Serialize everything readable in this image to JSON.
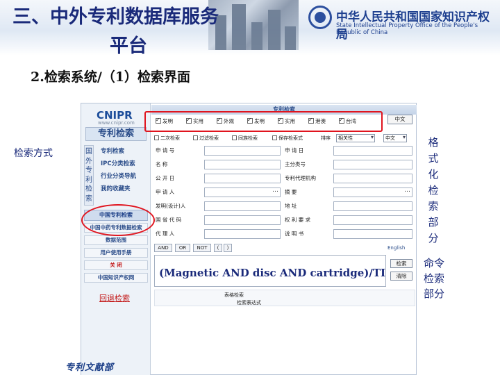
{
  "slide": {
    "title": "三、中外专利数据库服务平台",
    "title_line1": "三、中外专利数据库服务",
    "title_line2": "平台",
    "section": "2.检索系统/（1）检索界面",
    "logo_cn": "中华人民共和国国家知识产权局",
    "logo_en": "State Intellectual Property Office of the People's Republic of China",
    "left_label": "检索方式",
    "right_vertical_label": "格式化检索部分",
    "right_vertical_chars": [
      "格",
      "式",
      "化",
      "检",
      "索",
      "部",
      "分"
    ],
    "command_label_lines": [
      "命令",
      "检索",
      "部分"
    ]
  },
  "screenshot": {
    "brand": "CNIPR",
    "brand_url": "www.cnipr.com",
    "sidebar_tab": "专利检索",
    "vertical_menu": "国外专利检索",
    "menu_items": [
      "专利检索",
      "IPC分类检索",
      "行业分类导航",
      "我的收藏夹"
    ],
    "menu_buttons": [
      "中国专利检索",
      "中国中药专利数据检索",
      "数据范围",
      "用户使用手册",
      "关 闭",
      "中国知识产权网"
    ],
    "back_link": "回退检索",
    "footer_dept": "专利文献部",
    "search_heading": "专利检索",
    "databases": [
      "发明",
      "实用",
      "外观",
      "发明",
      "实用",
      "港澳",
      "台湾"
    ],
    "chinese_button": "中文",
    "options": [
      "二次检索",
      "过滤检索",
      "同族检索",
      "保存检索式",
      "排序"
    ],
    "sort_select": "相关性",
    "lang_select": "中文",
    "fields_left": [
      "申 请 号",
      "名   称",
      "公 开 日",
      "申 请 人",
      "发明(设计)人",
      "国 省 代 码",
      "代 理 人"
    ],
    "fields_right": [
      "申 请 日",
      "主分类号",
      "专利代理机构",
      "摘   要",
      "地   址",
      "权 利 要 求",
      "说 明 书"
    ],
    "ops": [
      "AND",
      "OR",
      "NOT",
      "(",
      ")"
    ],
    "lang_link": "English",
    "command_expression": "(Magnetic AND disc AND cartridge)/TI",
    "side_buttons": [
      "检索",
      "清除"
    ],
    "table_header_1": "表格检索",
    "table_header_2": "检索表达式"
  },
  "colors": {
    "title_blue": "#1a2a7a",
    "highlight_red": "#e0141e",
    "link_red": "#c21515"
  }
}
